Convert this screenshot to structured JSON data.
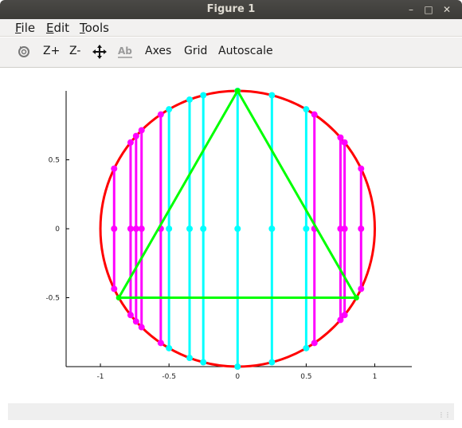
{
  "window": {
    "title": "Figure 1"
  },
  "menu": {
    "file": "File",
    "edit": "Edit",
    "tools": "Tools"
  },
  "toolbar": {
    "zoom_in": "Z+",
    "zoom_out": "Z-",
    "axes": "Axes",
    "grid": "Grid",
    "autoscale": "Autoscale"
  },
  "icons": [
    "rotate-icon",
    "pan-icon",
    "text-icon",
    "minimize-icon",
    "maximize-icon",
    "close-icon"
  ],
  "colors": {
    "circle": "#ff0000",
    "triangle": "#00ff00",
    "magenta": "#ff00ff",
    "cyan": "#00ffff"
  },
  "chart_data": {
    "type": "line",
    "title": "",
    "xlabel": "",
    "ylabel": "",
    "xlim": [
      -1.25,
      1.27
    ],
    "ylim": [
      -1,
      1
    ],
    "x_ticks": [
      -1,
      -0.5,
      0,
      0.5,
      1
    ],
    "x_tick_labels": [
      "-1",
      "-0.5",
      "0",
      "0.5",
      "1"
    ],
    "y_ticks": [
      0.5,
      0,
      -0.5
    ],
    "y_tick_labels": [
      "0.5",
      "0",
      "-0.5"
    ],
    "grid": false,
    "circle": {
      "center": [
        0,
        0
      ],
      "radius": 1,
      "color": "#ff0000"
    },
    "triangle": {
      "vertices": [
        [
          0,
          1
        ],
        [
          -0.866,
          -0.5
        ],
        [
          0.866,
          -0.5
        ],
        [
          0,
          1
        ]
      ],
      "color": "#00ff00"
    },
    "chords": [
      {
        "x": -0.9,
        "color": "#ff00ff"
      },
      {
        "x": -0.78,
        "color": "#ff00ff"
      },
      {
        "x": -0.74,
        "color": "#ff00ff"
      },
      {
        "x": -0.7,
        "color": "#ff00ff"
      },
      {
        "x": -0.56,
        "color": "#ff00ff"
      },
      {
        "x": -0.5,
        "color": "#00ffff"
      },
      {
        "x": -0.35,
        "color": "#00ffff"
      },
      {
        "x": -0.25,
        "color": "#00ffff"
      },
      {
        "x": 0,
        "color": "#00ffff"
      },
      {
        "x": 0.25,
        "color": "#00ffff"
      },
      {
        "x": 0.5,
        "color": "#00ffff"
      },
      {
        "x": 0.56,
        "color": "#ff00ff"
      },
      {
        "x": 0.75,
        "color": "#ff00ff"
      },
      {
        "x": 0.78,
        "color": "#ff00ff"
      },
      {
        "x": 0.9,
        "color": "#ff00ff"
      }
    ]
  }
}
